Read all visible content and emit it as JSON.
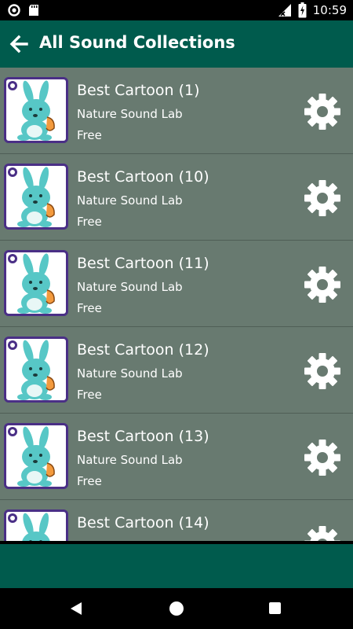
{
  "status_bar": {
    "time": "10:59"
  },
  "app_bar": {
    "title": "All Sound Collections"
  },
  "items": [
    {
      "title": "Best Cartoon (1)",
      "author": "Nature Sound Lab",
      "price": "Free"
    },
    {
      "title": "Best Cartoon (10)",
      "author": "Nature Sound Lab",
      "price": "Free"
    },
    {
      "title": "Best Cartoon (11)",
      "author": "Nature Sound Lab",
      "price": "Free"
    },
    {
      "title": "Best Cartoon (12)",
      "author": "Nature Sound Lab",
      "price": "Free"
    },
    {
      "title": "Best Cartoon (13)",
      "author": "Nature Sound Lab",
      "price": "Free"
    },
    {
      "title": "Best Cartoon (14)",
      "author": "",
      "price": ""
    }
  ],
  "colors": {
    "app_bar": "#005b4d",
    "list_background": "#687a70",
    "thumb_border": "#4a2f86",
    "bunny": "#57c7c6"
  }
}
